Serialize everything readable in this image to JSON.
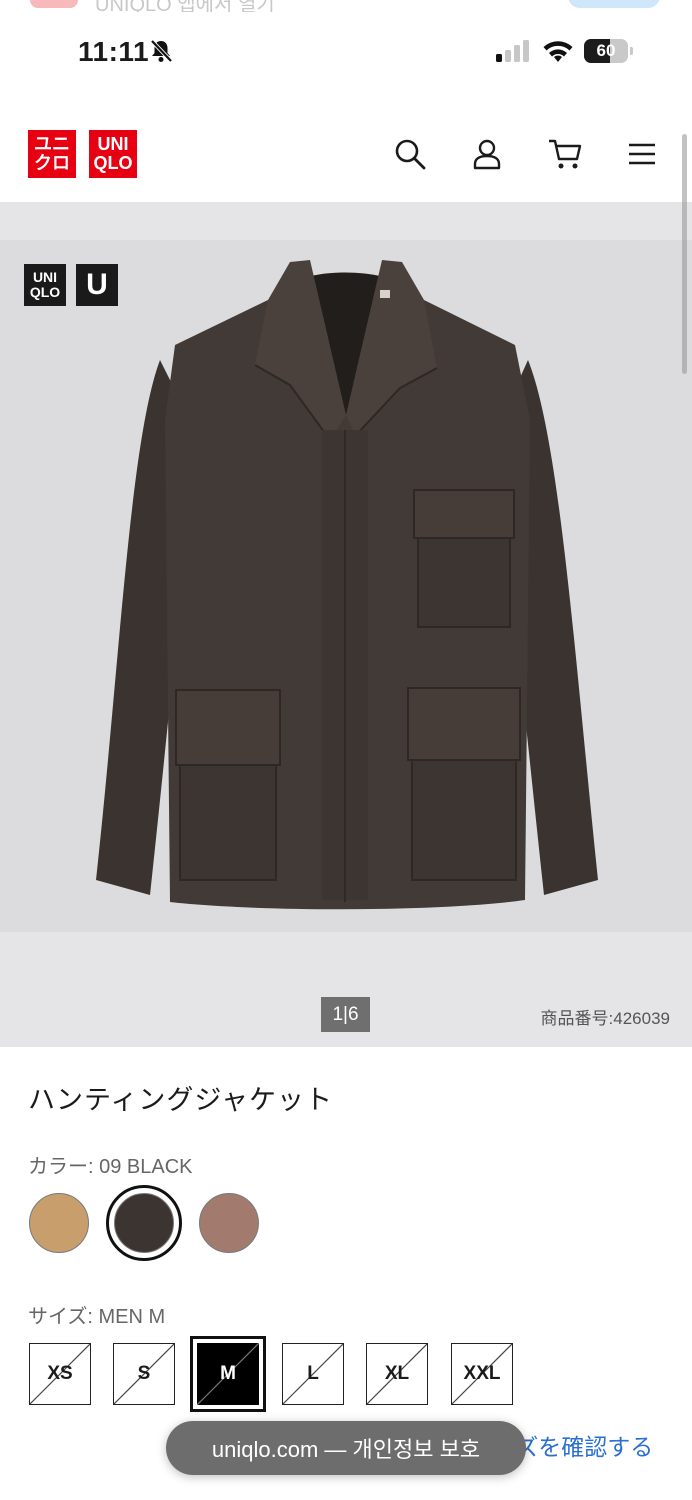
{
  "notification": {
    "text": "UNIQLO 앱에서 열기"
  },
  "status_bar": {
    "time": "11:11",
    "battery": "60",
    "battery_level": 0.6
  },
  "header": {
    "logo_kana": [
      "ユニ",
      "クロ"
    ],
    "logo_latin": [
      "UNI",
      "QLO"
    ],
    "icons": [
      "search-icon",
      "account-icon",
      "cart-icon",
      "menu-icon"
    ]
  },
  "gallery": {
    "badge_uniqlo": [
      "UNI",
      "QLO"
    ],
    "badge_u": "U",
    "counter": "1|6",
    "sku": "商品番号:426039"
  },
  "product": {
    "title": "ハンティングジャケット",
    "color_label": "カラー: 09 BLACK",
    "colors": [
      {
        "name": "camel",
        "hex": "#c89e6c"
      },
      {
        "name": "black",
        "hex": "#3c3431",
        "selected": true
      },
      {
        "name": "brown",
        "hex": "#a27a6e"
      }
    ],
    "size_label": "サイズ: MEN M",
    "sizes": [
      "XS",
      "S",
      "M",
      "L",
      "XL",
      "XXL"
    ],
    "selected_size": "M",
    "size_check": "サイズを確認する"
  },
  "browser": {
    "url_pill": "uniqlo.com — 개인정보 보호"
  },
  "colors": {
    "brand_red": "#e60012",
    "link_blue": "#2a6fd1"
  }
}
